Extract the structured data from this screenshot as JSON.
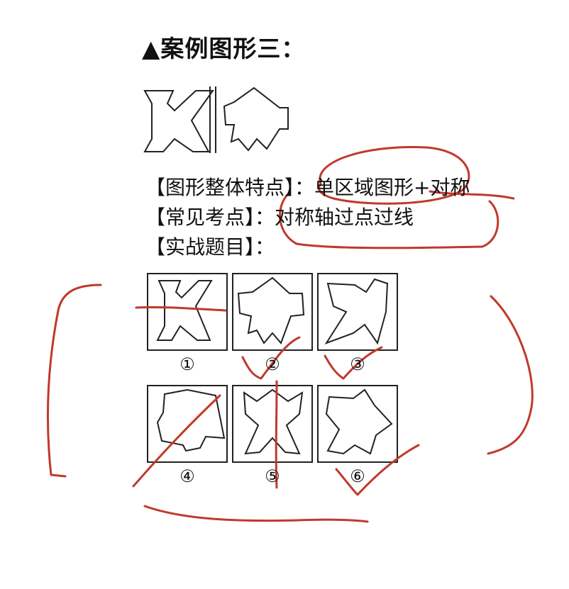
{
  "title": "▲案例图形三：",
  "lines": {
    "overall_features": "【图形整体特点】：单区域图形+对称",
    "common_points": "【常见考点】：对称轴过点过线",
    "practice": "【实战题目】："
  },
  "options": [
    "①",
    "②",
    "③",
    "④",
    "⑤",
    "⑥"
  ],
  "colors": {
    "annotation": "#c0392b",
    "ink": "#222222"
  }
}
